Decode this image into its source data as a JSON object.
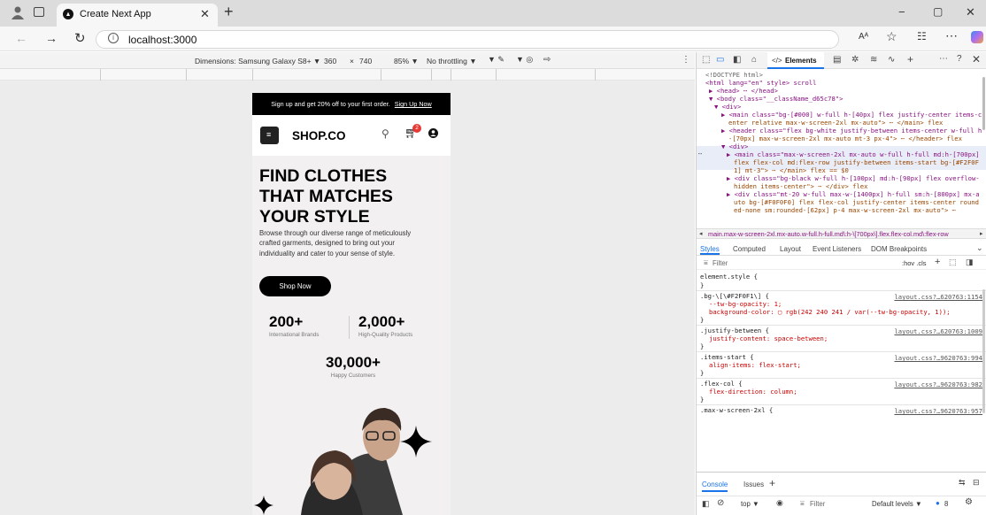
{
  "browser": {
    "tab_title": "Create Next App",
    "new_tab": "+",
    "url": "localhost:3000",
    "window_controls": [
      "−",
      "▢",
      "✕"
    ]
  },
  "device_toolbar": {
    "dimensions": "Dimensions: Samsung Galaxy S8+ ▼",
    "width": "360",
    "x": "×",
    "height": "740",
    "zoom": "85% ▼",
    "throttling": "No throttling ▼"
  },
  "site": {
    "promo": "Sign up and get 20% off to your first order.",
    "promo_link": "Sign Up Now",
    "logo": "SHOP.CO",
    "cart_count": "2",
    "hero_title": [
      "FIND CLOTHES",
      "THAT MATCHES",
      "YOUR STYLE"
    ],
    "hero_text": [
      "Browse through our diverse range of meticulously",
      "crafted garments, designed to bring out your",
      "individuality and cater to your sense of style."
    ],
    "cta": "Shop Now",
    "stats": [
      {
        "value": "200+",
        "label": "International Brands"
      },
      {
        "value": "2,000+",
        "label": "High-Quality Products"
      },
      {
        "value": "30,000+",
        "label": "Happy Customers"
      }
    ]
  },
  "devtools": {
    "elements_tab": "Elements",
    "dom": [
      "<!DOCTYPE html>",
      "<html lang=\"en\" style> scroll",
      "▶ <head> ⋯ </head>",
      "▼ <body class=\"__className_d65c78\">",
      "▼ <div>",
      "▶ <main class=\"bg-[#000] w-full h-[40px] flex justify-center items-c",
      "enter relative max-w-screen-2xl mx-auto\"> ⋯ </main> flex",
      "▶ <header class=\"flex bg-white justify-between items-center w-full h",
      "-[70px] max-w-screen-2xl mx-auto mt-3 px-4\"> ⋯ </header> flex",
      "▼ <div>",
      "▶ <main class=\"max-w-screen-2xl mx-auto w-full h-full md:h-[700px]",
      "flex flex-col md:flex-row justify-between items-start bg-[#F2F0F",
      "1] mt-3\"> ⋯ </main> flex == $0",
      "▶ <div class=\"bg-black w-full h-[100px] md:h-[90px] flex overflow-",
      "hidden items-center\"> ⋯ </div> flex",
      "▶ <div class=\"mt-20 w-full max-w-[1400px] h-full sm:h-[800px] mx-a",
      "uto bg-[#F0F0F0] flex flex-col justify-center items-center round",
      "ed-none sm:rounded-[62px] p-4 max-w-screen-2xl mx-auto\"> ⋯"
    ],
    "breadcrumb": "main.max-w-screen-2xl.mx-auto.w-full.h-full.md\\:h-\\[700px\\].flex.flex-col.md\\:flex-row",
    "style_tabs": [
      "Styles",
      "Computed",
      "Layout",
      "Event Listeners",
      "DOM Breakpoints"
    ],
    "filter": "Filter",
    "hov_cls": ":hov .cls",
    "rules": [
      {
        "selector": "element.style {",
        "file": "",
        "props": []
      },
      {
        "selector": ".bg-\\[\\#F2F0F1\\] {",
        "file": "layout.css?…620763:1154",
        "props": [
          "--tw-bg-opacity: 1;",
          "background-color: ▢ rgb(242 240 241 / var(--tw-bg-opacity, 1));"
        ]
      },
      {
        "selector": ".justify-between {",
        "file": "layout.css?…620763:1009",
        "props": [
          "justify-content: space-between;"
        ]
      },
      {
        "selector": ".items-start {",
        "file": "layout.css?…9620763:994",
        "props": [
          "align-items: flex-start;"
        ]
      },
      {
        "selector": ".flex-col {",
        "file": "layout.css?…9620763:982",
        "props": [
          "flex-direction: column;"
        ]
      },
      {
        "selector": ".max-w-screen-2xl {",
        "file": "layout.css?…9620763:957",
        "props": []
      }
    ],
    "console_tabs": [
      "Console",
      "Issues",
      "+"
    ],
    "console_bar": {
      "context": "top ▼",
      "filter": "Filter",
      "levels": "Default levels ▼",
      "count": "8"
    }
  }
}
